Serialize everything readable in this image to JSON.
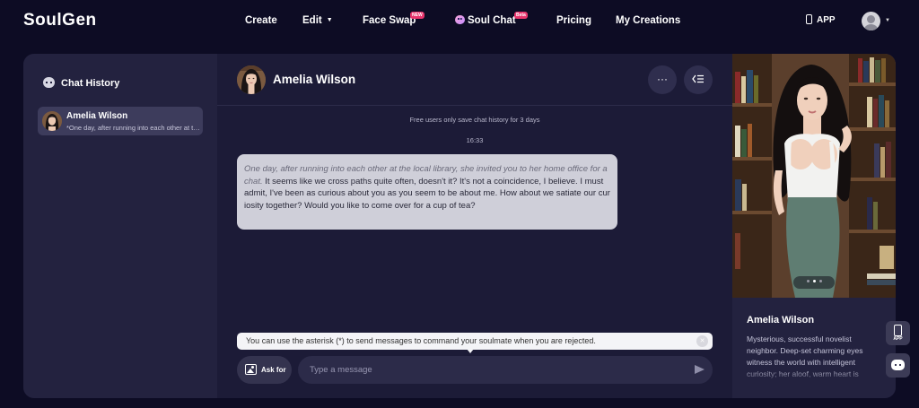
{
  "brand": {
    "logo": "SoulGen"
  },
  "nav": {
    "create": "Create",
    "edit": "Edit",
    "face_swap": "Face Swap",
    "face_swap_badge": "NEW",
    "soul_chat": "Soul Chat",
    "soul_chat_badge": "Beta",
    "pricing": "Pricing",
    "my_creations": "My Creations",
    "app": "APP"
  },
  "sidebar": {
    "title": "Chat History",
    "items": [
      {
        "name": "Amelia Wilson",
        "preview": "*One day, after running into each other at the local library, she invited you to her home office for a chat."
      }
    ]
  },
  "chat": {
    "name": "Amelia Wilson",
    "more_icon": "more-horizontal-icon",
    "collapse_icon": "collapse-panel-icon",
    "notice": "Free users only save chat history for 3 days",
    "timestamp": "16:33",
    "message": {
      "narration": "One day, after running into each other at the local library, she invited you to her home office for a chat.",
      "text": " It seems like we cross paths quite often, doesn't it? It's not a coincidence, I believe. I must admit, I've been as curious about you as you seem to be about me. How about we satiate our curiosity together? Would you like to come over for a cup of tea?"
    },
    "hint": "You can use the asterisk (*) to send messages to command your soulmate when you are rejected.",
    "ask_label": "Ask for",
    "input_placeholder": "Type a message"
  },
  "profile": {
    "name": "Amelia Wilson",
    "description": "Mysterious, successful novelist neighbor. Deep-set charming eyes witness the world with intelligent curiosity; her aloof, warm heart is"
  },
  "float": {
    "app_label": "APP"
  },
  "colors": {
    "background": "#0d0c24",
    "panel": "#1c1b37",
    "sidebar": "#23223f",
    "accent_badge": "#e8356d"
  }
}
